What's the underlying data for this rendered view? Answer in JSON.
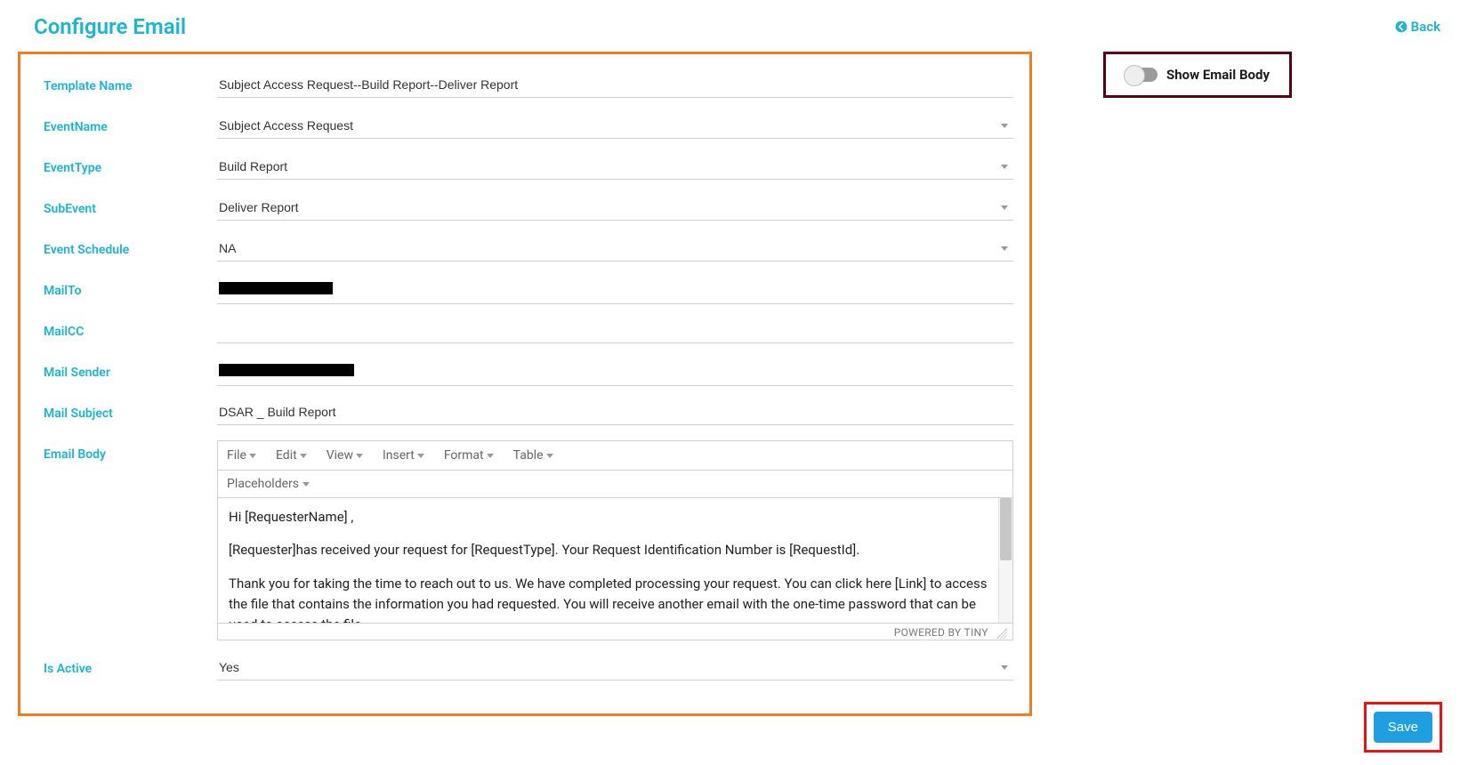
{
  "header": {
    "title": "Configure Email",
    "back": "Back"
  },
  "toggle": {
    "label": "Show Email Body"
  },
  "form": {
    "templateName": {
      "label": "Template Name",
      "value": "Subject Access Request--Build Report--Deliver Report"
    },
    "eventName": {
      "label": "EventName",
      "value": "Subject Access Request"
    },
    "eventType": {
      "label": "EventType",
      "value": "Build Report"
    },
    "subEvent": {
      "label": "SubEvent",
      "value": "Deliver Report"
    },
    "eventSchedule": {
      "label": "Event Schedule",
      "value": "NA"
    },
    "mailTo": {
      "label": "MailTo"
    },
    "mailCC": {
      "label": "MailCC",
      "value": ""
    },
    "mailSender": {
      "label": "Mail Sender"
    },
    "mailSubject": {
      "label": "Mail Subject",
      "value": "DSAR _ Build Report"
    },
    "emailBody": {
      "label": "Email Body"
    },
    "isActive": {
      "label": "Is Active",
      "value": "Yes"
    }
  },
  "editor": {
    "menus": {
      "file": "File",
      "edit": "Edit",
      "view": "View",
      "insert": "Insert",
      "format": "Format",
      "table": "Table"
    },
    "placeholders": "Placeholders",
    "footer": "POWERED BY TINY",
    "body": {
      "p1": "Hi [RequesterName] ,",
      "p2": "[Requester]has received your request for [RequestType]. Your Request Identification Number is [RequestId].",
      "p3": "Thank you for taking the time to reach out to us. We have completed processing your request.  You can click here [Link] to access the file that contains the information you had requested. You will receive another email with the one-time password that can be used to access the file"
    }
  },
  "actions": {
    "save": "Save"
  }
}
